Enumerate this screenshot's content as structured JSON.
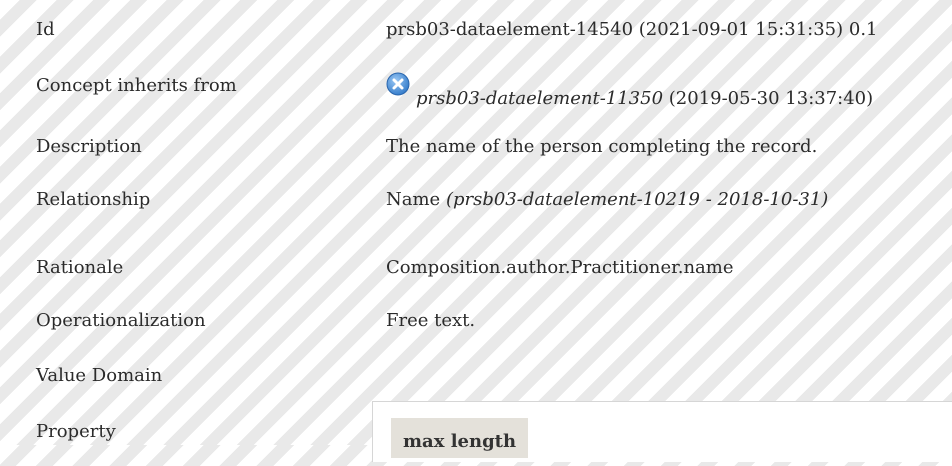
{
  "rows": {
    "id": {
      "label": "Id",
      "value": "prsb03-dataelement-14540 (2021-09-01 15:31:35) 0.1"
    },
    "inherits": {
      "label": "Concept inherits from",
      "link": "prsb03-dataelement-11350",
      "date": " (2019-05-30 13:37:40)",
      "icon": "close-circle-icon",
      "icon_color": "#4a90d9"
    },
    "description": {
      "label": "Description",
      "value": "The name of the person completing the record."
    },
    "relationship": {
      "label": "Relationship",
      "name": "Name",
      "ref": "(prsb03-dataelement-10219 - 2018-10-31)"
    },
    "rationale": {
      "label": "Rationale",
      "value": "Composition.author.Practitioner.name"
    },
    "operationalization": {
      "label": "Operationalization",
      "value": "Free text."
    },
    "value_domain": {
      "label": "Value Domain"
    },
    "property": {
      "label": "Property",
      "column_header": "max length"
    }
  }
}
